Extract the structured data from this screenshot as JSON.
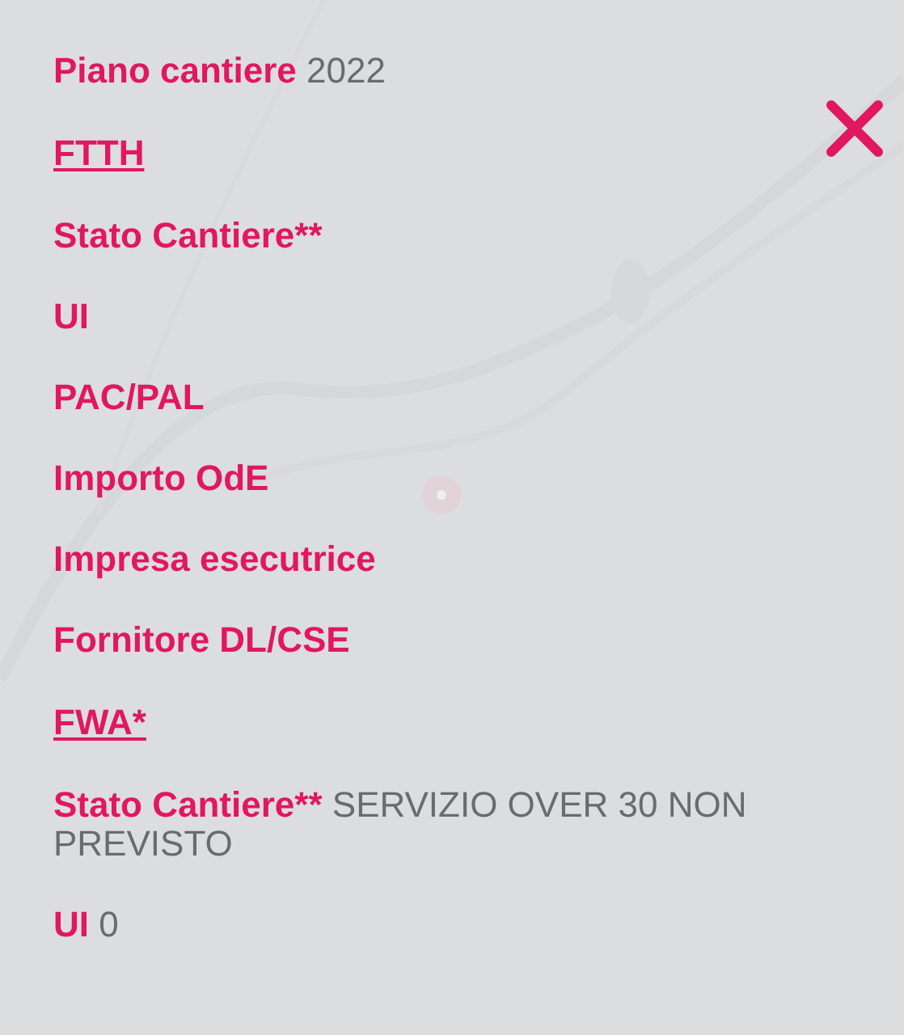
{
  "rows": [
    {
      "kind": "field",
      "label": "Piano cantiere",
      "value": "2022"
    },
    {
      "kind": "section",
      "label": "FTTH"
    },
    {
      "kind": "field",
      "label": "Stato Cantiere**"
    },
    {
      "kind": "field",
      "label": "UI"
    },
    {
      "kind": "field",
      "label": "PAC/PAL"
    },
    {
      "kind": "field",
      "label": "Importo OdE"
    },
    {
      "kind": "field",
      "label": "Impresa esecutrice"
    },
    {
      "kind": "field",
      "label": "Fornitore DL/CSE"
    },
    {
      "kind": "section",
      "label": "FWA*"
    },
    {
      "kind": "field",
      "label": "Stato Cantiere**",
      "value": "SERVIZIO OVER 30 NON PREVISTO"
    },
    {
      "kind": "field",
      "label": "UI",
      "value": "0"
    }
  ]
}
